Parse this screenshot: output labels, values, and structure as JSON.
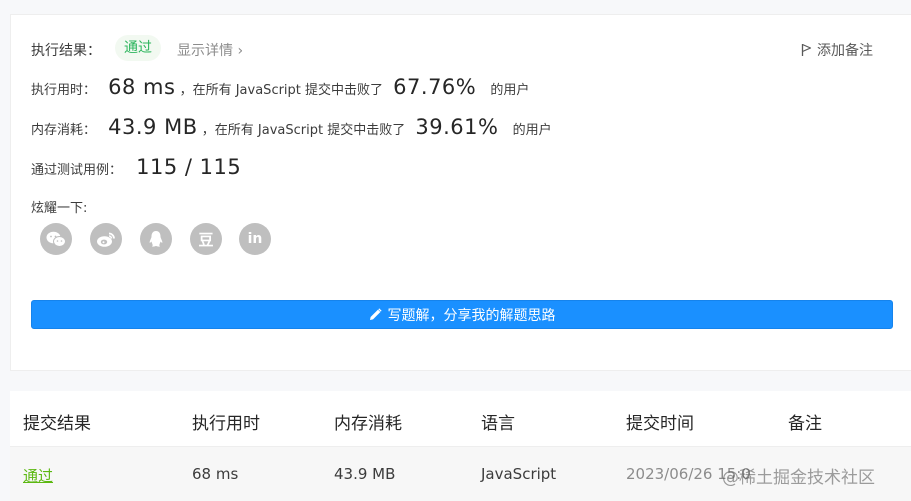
{
  "result": {
    "label": "执行结果：",
    "status": "通过",
    "details_link": "显示详情 ›",
    "add_note": "添加备注"
  },
  "runtime": {
    "label": "执行用时：",
    "value": "68 ms",
    "prefix": "，在所有 JavaScript 提交中击败了",
    "percent": "67.76%",
    "suffix": "的用户"
  },
  "memory": {
    "label": "内存消耗：",
    "value": "43.9 MB",
    "prefix": "，在所有 JavaScript 提交中击败了",
    "percent": "39.61%",
    "suffix": "的用户"
  },
  "tests": {
    "label": "通过测试用例：",
    "value": "115 / 115"
  },
  "share": {
    "label": "炫耀一下:",
    "icons": [
      "wechat-icon",
      "weibo-icon",
      "qq-icon",
      "douban-icon",
      "linkedin-icon"
    ],
    "douban_glyph": "豆",
    "linkedin_glyph": "in"
  },
  "write_button": "写题解，分享我的解题思路",
  "table": {
    "headers": [
      "提交结果",
      "执行用时",
      "内存消耗",
      "语言",
      "提交时间",
      "备注"
    ],
    "row": {
      "result": "通过",
      "runtime": "68 ms",
      "memory": "43.9 MB",
      "language": "JavaScript",
      "time": "2023/06/26 15:0"
    }
  },
  "watermark": "@稀土掘金技术社区",
  "colors": {
    "accent": "#1a90ff",
    "success": "#2db55d",
    "pass_link": "#5cb811"
  }
}
